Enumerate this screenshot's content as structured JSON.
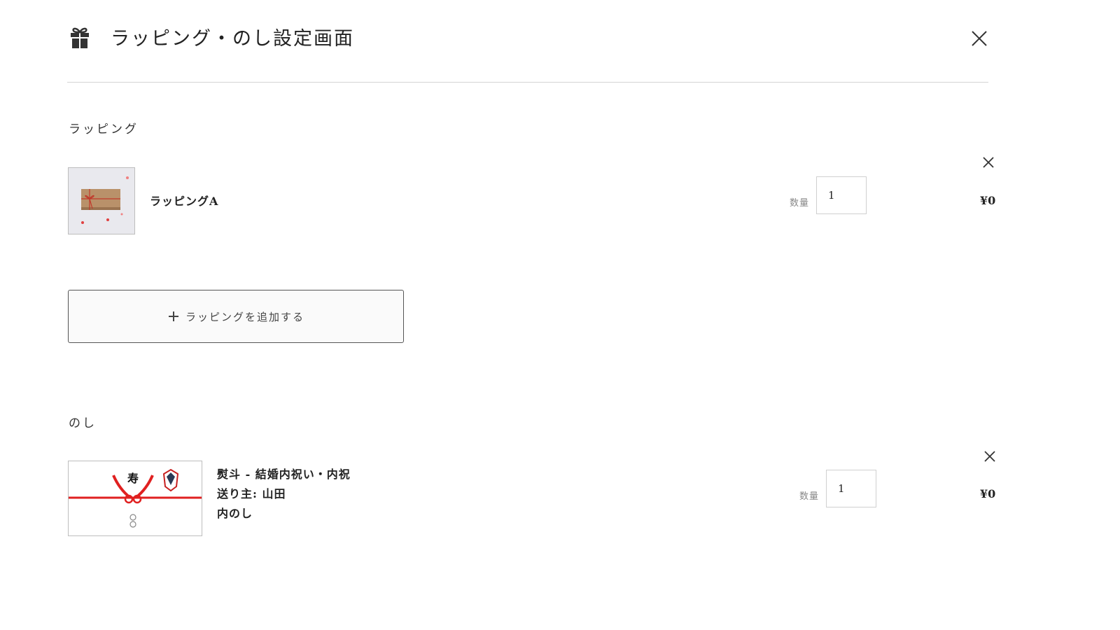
{
  "dialog": {
    "title": "ラッピング・のし設定画面"
  },
  "wrapping": {
    "section_label": "ラッピング",
    "items": [
      {
        "name": "ラッピングA",
        "qty_label": "数量",
        "qty": "1",
        "price": "¥0"
      }
    ],
    "add_button_label": "ラッピングを追加する"
  },
  "noshi": {
    "section_label": "のし",
    "items": [
      {
        "lines": [
          "熨斗 - 結婚内祝い・内祝",
          "送り主: 山田",
          "内のし"
        ],
        "qty_label": "数量",
        "qty": "1",
        "price": "¥0",
        "image_text": "寿"
      }
    ]
  }
}
